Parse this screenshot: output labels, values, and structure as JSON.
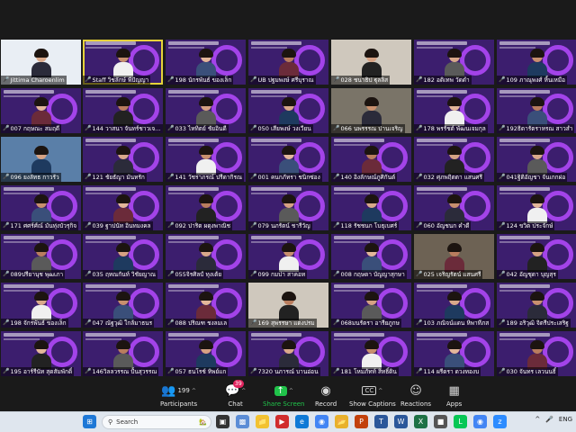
{
  "gallery": {
    "tiles": [
      [
        "Jittima Charoenlim",
        "Staff วิชลักษ์ พีปัญญา",
        "198 นักรพันธ์ ของเล็ก",
        "UB ปฐมพงษ์ ศรีบุราณ",
        "028 ชนาธิป ฐุลลิส",
        "182 อดิเทพ วัดดำ",
        "109 ภาณุพงศ์ หิ้นเหมือ"
      ],
      [
        "007 กฤษณะ สมฤดี",
        "144 วาสนา จันทร์ชาวเจริญ",
        "033 ไหทิตย์ ชัยอินดี",
        "050 เสียพงษ์ วงเวียน",
        "066 นพรรรณ ปานเจริญ",
        "178 พรรัชต์ พัฒนเจมกุล",
        "192ธิดารัตราหรณ สาวสำ"
      ],
      [
        "096 ยงลัทธ กาวรัว",
        "121 ชัยธัญา มันทรัก",
        "141 วัชราภรณ์ ปรีดากิรณ",
        "001 คนกภัทรา ชนิกซ่อง",
        "140 อิงลักษณ์ภูศิกันต์",
        "032 ศุภพฤิตตา แสนศรี",
        "041ฐิติอัญชา จันเกกผ่อ"
      ],
      [
        "171 ศศร์ศ์ณ์ มันทุ่งบัวรุกิจ",
        "039 ฐาปนัท อินทมงคล",
        "092 ปาริต ผดุงพาณิช",
        "079 นภรัตน์ ชารีวัญ",
        "118 รัชชนก โบธุเบศร์",
        "060 อัญชนก คำดี",
        "124 ขวิต ประจักษ์"
      ],
      [
        "089ปรียานุช พุฒเภา",
        "035 ฤทณกันท์ วิชัยญาณ",
        "055จิรศิลป์ ทุงเต้ย",
        "099 กมปา สาคอท",
        "008 กฤษดา บัญญาสุกษา",
        "025 เจริญรัตน์ แสนศรี",
        "042 อัญชุดา บุญสุร"
      ],
      [
        "198 จักรพันธ์ ของเล็ก",
        "047 ณัฐวุฒิ ใกล้มาธนร",
        "088 ปริณฑ ชงลมเล",
        "169 สุพรรษา แตงปรม",
        "068มนรัตรา อารียภูกษ",
        "103 ภณิจน์แดน หิพาทีภส",
        "189 อริวุฒิ จิตรีประเสริฐ"
      ],
      [
        "195 อาร์รีนัท สุดสัมพักดิ์",
        "146วิลลวรรณ ปั้นสุวรรณ",
        "057 ธนโรช์ ทิพย์แก",
        "7320 นภารณ์ บานอ่อน",
        "181 โหมภัทท์ สิทธิ์ดิน",
        "114 ผรีดรา ดวงทองบ",
        "030 จันทร เลวนนธิ์"
      ]
    ]
  },
  "toolbar": {
    "participants_label": "Participants",
    "participants_count": "199",
    "chat_label": "Chat",
    "chat_badge": "39",
    "share_label": "Share Screen",
    "record_label": "Record",
    "captions_label": "Show Captions",
    "captions_icon": "CC",
    "reactions_label": "Reactions",
    "apps_label": "Apps"
  },
  "taskbar": {
    "search_placeholder": "Search",
    "language": "ENG"
  },
  "colors": {
    "tile_bg": "#3c1e6e",
    "ring": "#b54aff",
    "share_green": "#20c34a",
    "active_speaker": "#e6d23a",
    "mic_muted": "#ff4a4a"
  }
}
